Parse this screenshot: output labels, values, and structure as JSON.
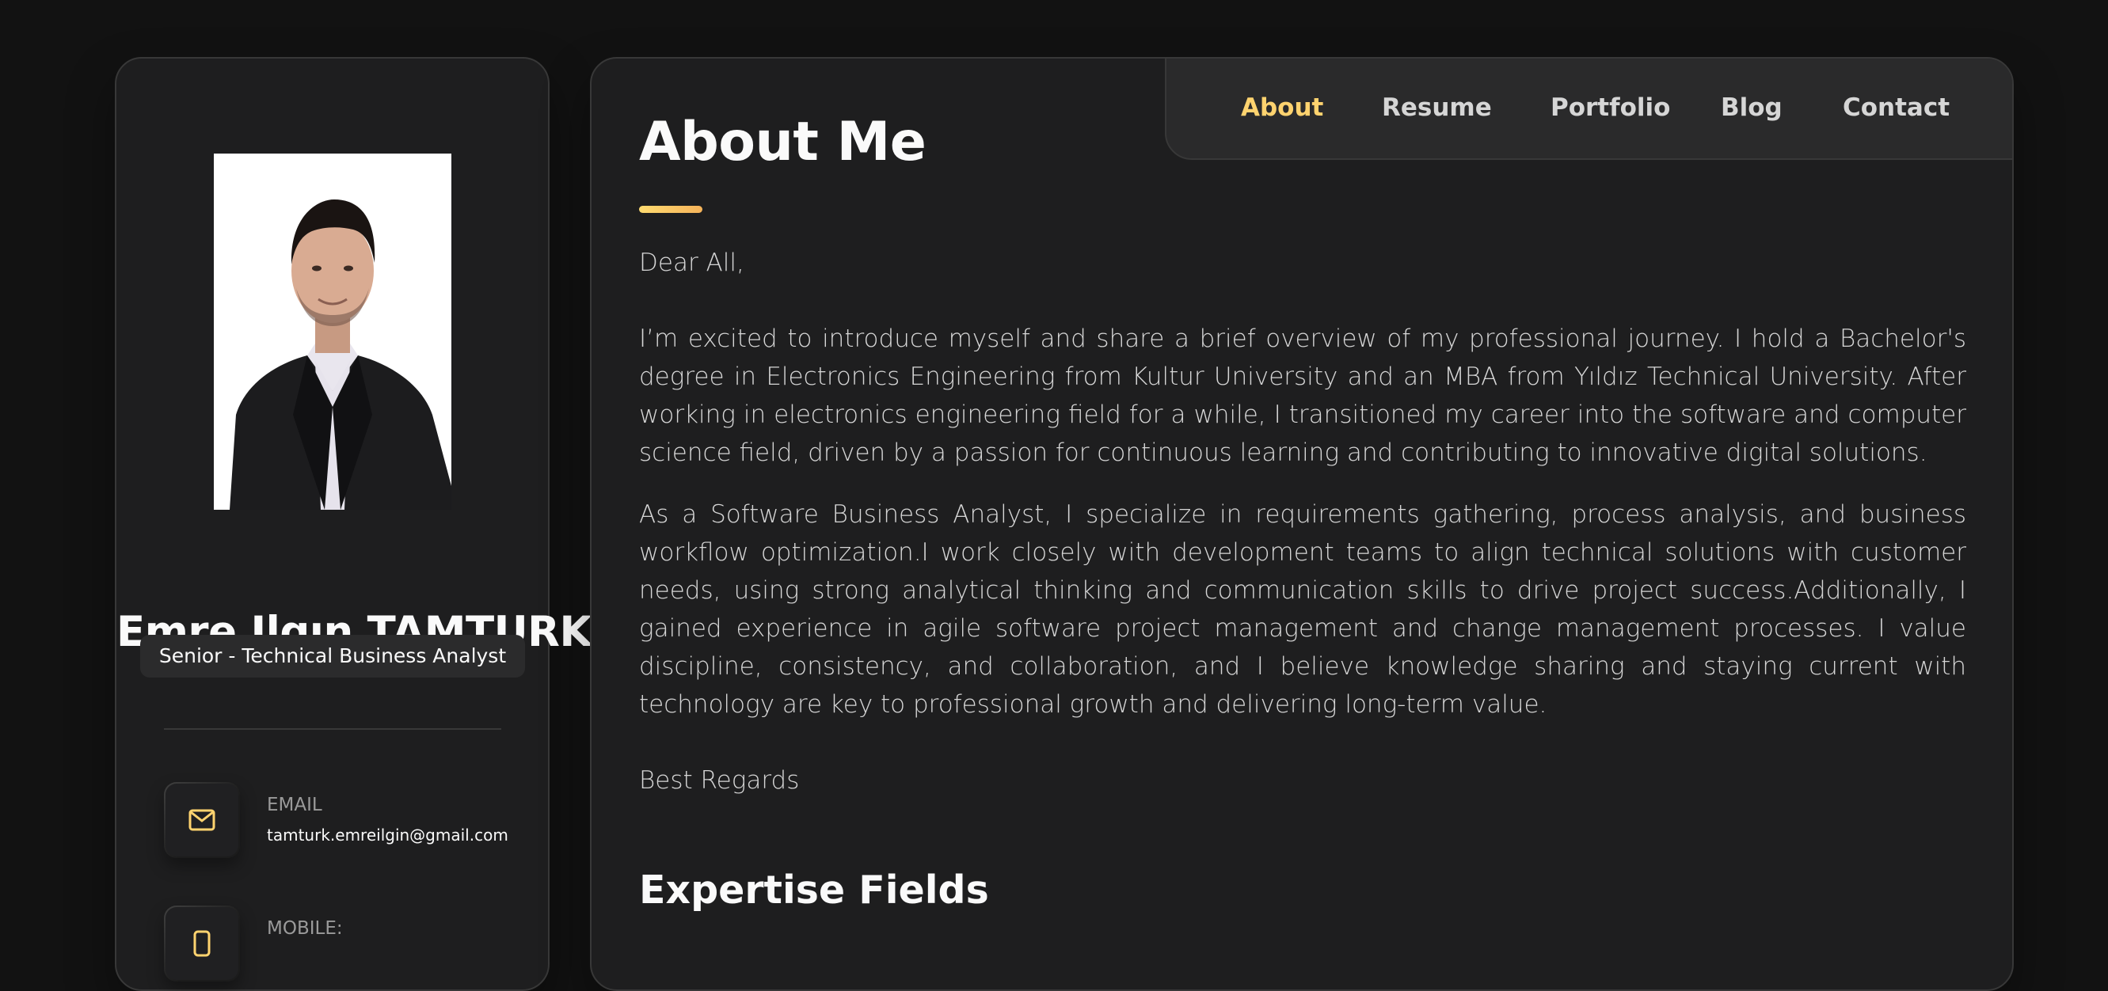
{
  "profile": {
    "name": "Emre Ilgın TAMTURK",
    "title": "Senior - Technical Business Analyst",
    "contacts": [
      {
        "label": "EMAIL",
        "value": "tamturk.emreilgin@gmail.com",
        "icon": "mail-icon"
      },
      {
        "label": "MOBILE:",
        "value": "",
        "icon": "phone-icon"
      }
    ]
  },
  "nav": {
    "items": [
      {
        "label": "About",
        "active": true
      },
      {
        "label": "Resume",
        "active": false
      },
      {
        "label": "Portfolio",
        "active": false
      },
      {
        "label": "Blog",
        "active": false
      },
      {
        "label": "Contact",
        "active": false
      }
    ]
  },
  "about": {
    "heading": "About Me",
    "greeting": "Dear All,",
    "paragraphs": [
      "I’m excited to introduce myself and share a brief overview of my professional journey. I hold a Bachelor's degree in Electronics Engineering from Kultur University and an MBA from Yıldız Technical University. After working in electronics engineering field for a while, I transitioned my career into the software and computer science field, driven by a passion for continuous learning and contributing to innovative digital solutions.",
      "As a Software Business Analyst, I specialize in requirements gathering, process analysis, and business workflow optimization.I work closely with development teams to align technical solutions with customer needs, using strong analytical thinking and communication skills to drive project success.Additionally, I gained experience in agile software project management and change management processes. I value discipline, consistency, and collaboration, and I believe knowledge sharing and staying current with technology are key to professional growth and delivering long-term value."
    ],
    "closing": "Best Regards",
    "expertise_heading": "Expertise Fields"
  },
  "colors": {
    "background": "#121212",
    "card": "#1e1e1f",
    "accent": "#ffd36f",
    "text": "#fafafa",
    "muted": "#d6d6d6"
  }
}
